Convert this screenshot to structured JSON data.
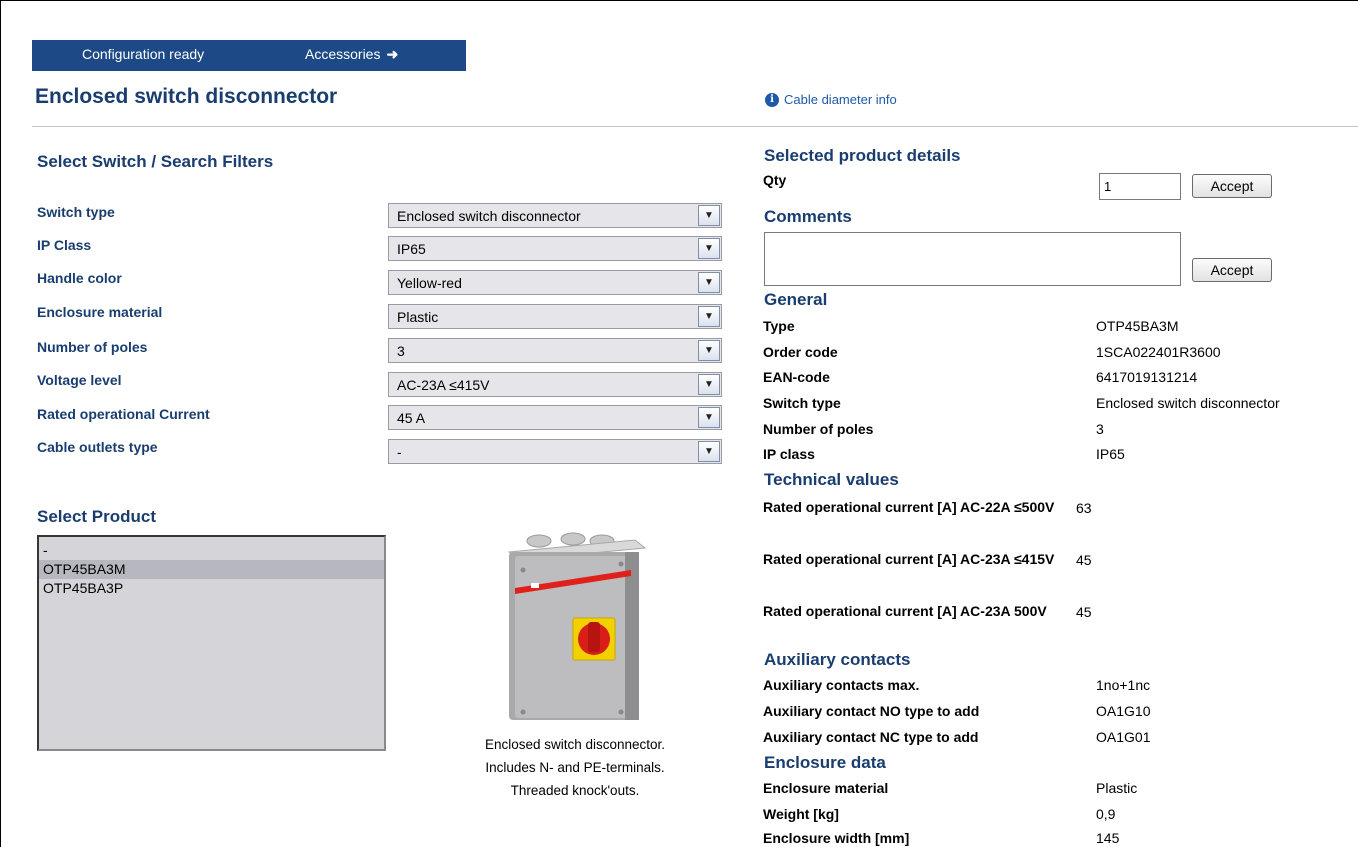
{
  "nav": {
    "config_ready": "Configuration ready",
    "accessories": "Accessories"
  },
  "page": {
    "title": "Enclosed switch disconnector",
    "cable_info": "Cable diameter info"
  },
  "filters": {
    "heading": "Select Switch / Search Filters",
    "rows": [
      {
        "label": "Switch type",
        "value": "Enclosed switch disconnector"
      },
      {
        "label": "IP Class",
        "value": "IP65"
      },
      {
        "label": "Handle color",
        "value": "Yellow-red"
      },
      {
        "label": "Enclosure material",
        "value": "Plastic"
      },
      {
        "label": "Number of poles",
        "value": "3"
      },
      {
        "label": "Voltage level",
        "value": "AC-23A ≤415V"
      },
      {
        "label": "Rated operational Current",
        "value": "45 A"
      },
      {
        "label": "Cable outlets type",
        "value": "-"
      }
    ]
  },
  "product_select": {
    "heading": "Select Product",
    "options": [
      "-",
      "OTP45BA3M",
      "OTP45BA3P"
    ],
    "selected": "OTP45BA3M"
  },
  "product_image": {
    "caption_lines": [
      "Enclosed switch disconnector.",
      "Includes N- and PE-terminals.",
      "Threaded knock'outs."
    ]
  },
  "details": {
    "heading": "Selected product details",
    "qty_label": "Qty",
    "qty_value": "1",
    "accept_label": "Accept",
    "comments_heading": "Comments",
    "comments_value": "",
    "general": {
      "heading": "General",
      "rows": [
        {
          "label": "Type",
          "value": "OTP45BA3M"
        },
        {
          "label": "Order code",
          "value": "1SCA022401R3600"
        },
        {
          "label": "EAN-code",
          "value": "6417019131214"
        },
        {
          "label": "Switch type",
          "value": "Enclosed switch disconnector"
        },
        {
          "label": "Number of poles",
          "value": "3"
        },
        {
          "label": "IP class",
          "value": "IP65"
        }
      ]
    },
    "technical": {
      "heading": "Technical values",
      "rows": [
        {
          "label": "Rated operational current [A] AC-22A ≤500V",
          "value": "63"
        },
        {
          "label": "Rated operational current [A] AC-23A ≤415V",
          "value": "45"
        },
        {
          "label": "Rated operational current [A] AC-23A 500V",
          "value": "45"
        }
      ]
    },
    "auxiliary": {
      "heading": "Auxiliary contacts",
      "rows": [
        {
          "label": "Auxiliary contacts max.",
          "value": "1no+1nc"
        },
        {
          "label": "Auxiliary contact NO type to add",
          "value": "OA1G10"
        },
        {
          "label": "Auxiliary contact NC type to add",
          "value": "OA1G01"
        }
      ]
    },
    "enclosure": {
      "heading": "Enclosure data",
      "rows": [
        {
          "label": "Enclosure material",
          "value": "Plastic"
        },
        {
          "label": "Weight [kg]",
          "value": "0,9"
        },
        {
          "label": "Enclosure width [mm]",
          "value": "145"
        }
      ]
    }
  },
  "colors": {
    "nav_bg": "#1d4a86",
    "heading": "#1a3d70",
    "link": "#1f5aa8"
  },
  "icons": {
    "info": "info-circle-icon",
    "arrow": "arrow-right-icon",
    "dropdown": "chevron-down-icon"
  }
}
